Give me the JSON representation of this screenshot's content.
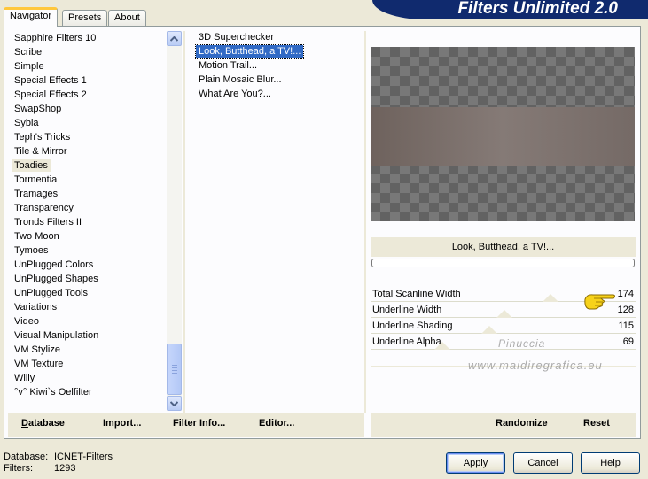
{
  "tabs": [
    "Navigator",
    "Presets",
    "About"
  ],
  "app_title": "Filters Unlimited 2.0",
  "categories": [
    "Sapphire Filters 10",
    "Scribe",
    "Simple",
    "Special Effects 1",
    "Special Effects 2",
    "SwapShop",
    "Sybia",
    "Teph's Tricks",
    "Tile & Mirror",
    "Toadies",
    "Tormentia",
    "Tramages",
    "Transparency",
    "Tronds Filters II",
    "Two Moon",
    "Tymoes",
    "UnPlugged Colors",
    "UnPlugged Shapes",
    "UnPlugged Tools",
    "Variations",
    "Video",
    "Visual Manipulation",
    "VM Stylize",
    "VM Texture",
    "Willy",
    "°v° Kiwi`s Oelfilter"
  ],
  "selected_category": "Toadies",
  "filters": [
    "3D Superchecker",
    "Look, Butthead, a TV!...",
    "Motion Trail...",
    "Plain Mosaic Blur...",
    "What Are You?..."
  ],
  "selected_filter": "Look, Butthead, a TV!...",
  "preview_filter_name": "Look, Butthead, a TV!...",
  "params": [
    {
      "name": "Total Scanline Width",
      "value": "174"
    },
    {
      "name": "Underline Width",
      "value": "128"
    },
    {
      "name": "Underline Shading",
      "value": "115"
    },
    {
      "name": "Underline Alpha",
      "value": "69"
    }
  ],
  "watermark": {
    "line1": "Pinuccia",
    "line2": "www.maidiregrafica.eu"
  },
  "left_commands": {
    "database": "Database",
    "import": "Import...",
    "filter_info": "Filter Info...",
    "editor": "Editor..."
  },
  "right_commands": {
    "randomize": "Randomize",
    "reset": "Reset"
  },
  "status": {
    "database_label": "Database:",
    "database_value": "ICNET-Filters",
    "filters_label": "Filters:",
    "filters_value": "1293"
  },
  "buttons": {
    "apply": "Apply",
    "cancel": "Cancel",
    "help": "Help"
  },
  "colors": {
    "selection": "#316ac5",
    "banner": "#102a6e",
    "dialog": "#ece9d8",
    "tab_highlight": "#ffc73c"
  },
  "icons": {
    "scroll_up": "chevron-up-icon",
    "scroll_down": "chevron-down-icon",
    "pointer": "pointing-hand-icon"
  }
}
